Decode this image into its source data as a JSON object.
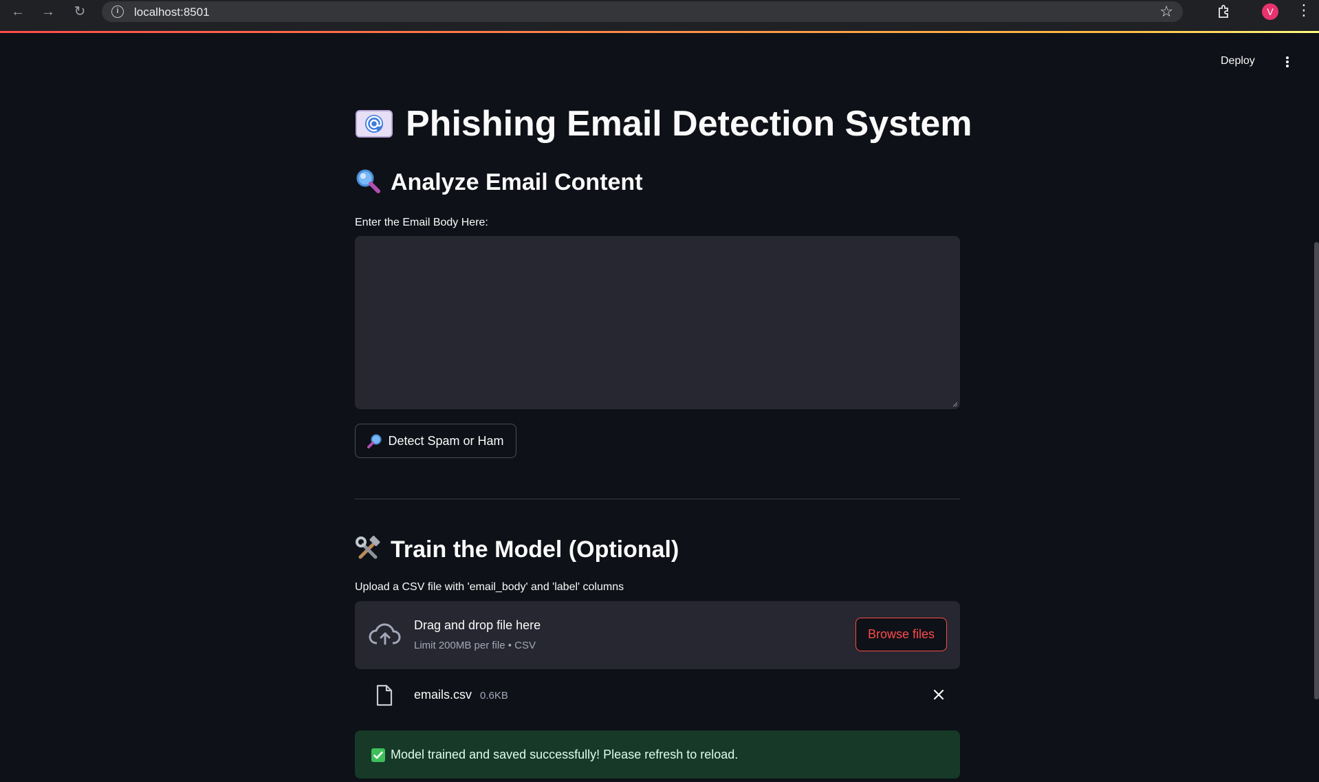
{
  "browser": {
    "url": "localhost:8501",
    "profile_initial": "V"
  },
  "header": {
    "deploy_label": "Deploy"
  },
  "app": {
    "title": "Phishing Email Detection System",
    "title_icon": "email-at-icon",
    "analyze": {
      "heading": "Analyze Email Content",
      "heading_icon": "magnifier-icon",
      "input_label": "Enter the Email Body Here:",
      "input_value": "",
      "button_label": "Detect Spam or Ham",
      "button_icon": "magnifier-icon"
    },
    "train": {
      "heading": "Train the Model (Optional)",
      "heading_icon": "hammer-wrench-icon",
      "upload_label": "Upload a CSV file with 'email_body' and 'label' columns",
      "drop_text": "Drag and drop file here",
      "limit_text": "Limit 200MB per file • CSV",
      "browse_label": "Browse files",
      "uploaded_file": {
        "name": "emails.csv",
        "size": "0.6KB"
      },
      "success_message": "Model trained and saved successfully! Please refresh to reload."
    }
  },
  "colors": {
    "background": "#0e1117",
    "input_bg": "#262730",
    "accent_red": "#ff4b4b",
    "success_bg": "#173928",
    "success_text": "#dffde9"
  }
}
